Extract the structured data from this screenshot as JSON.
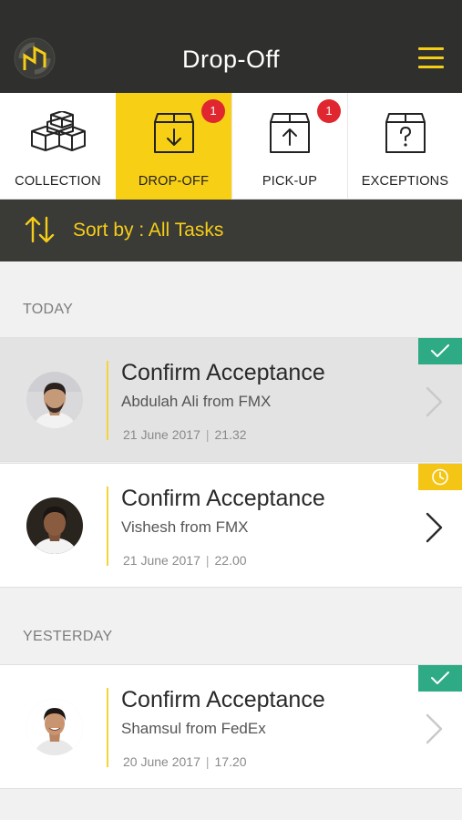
{
  "header": {
    "title": "Drop-Off",
    "colors": {
      "background": "#2f2f2d",
      "accent": "#f5cd17"
    }
  },
  "tabs": [
    {
      "label": "COLLECTION",
      "icon": "boxes-icon",
      "badge": null,
      "active": false
    },
    {
      "label": "DROP-OFF",
      "icon": "box-down-icon",
      "badge": "1",
      "active": true
    },
    {
      "label": "PICK-UP",
      "icon": "box-up-icon",
      "badge": "1",
      "active": false
    },
    {
      "label": "EXCEPTIONS",
      "icon": "box-question-icon",
      "badge": null,
      "active": false
    }
  ],
  "sort": {
    "label": "Sort by : All Tasks",
    "icon": "sort-arrows-icon"
  },
  "sections": [
    {
      "header": "TODAY",
      "tasks": [
        {
          "title": "Confirm Acceptance",
          "subtitle": "Abdulah Ali from FMX",
          "date": "21 June 2017",
          "time": "21.32",
          "status": "completed",
          "status_icon": "check-icon"
        },
        {
          "title": "Confirm Acceptance",
          "subtitle": "Vishesh from FMX",
          "date": "21 June 2017",
          "time": "22.00",
          "status": "pending",
          "status_icon": "clock-icon"
        }
      ]
    },
    {
      "header": "YESTERDAY",
      "tasks": [
        {
          "title": "Confirm Acceptance",
          "subtitle": "Shamsul from FedEx",
          "date": "20 June 2017",
          "time": "17.20",
          "status": "completed",
          "status_icon": "check-icon"
        }
      ]
    }
  ],
  "status_colors": {
    "completed": "#2eab84",
    "pending": "#f4c515",
    "badge": "#e0262f"
  }
}
